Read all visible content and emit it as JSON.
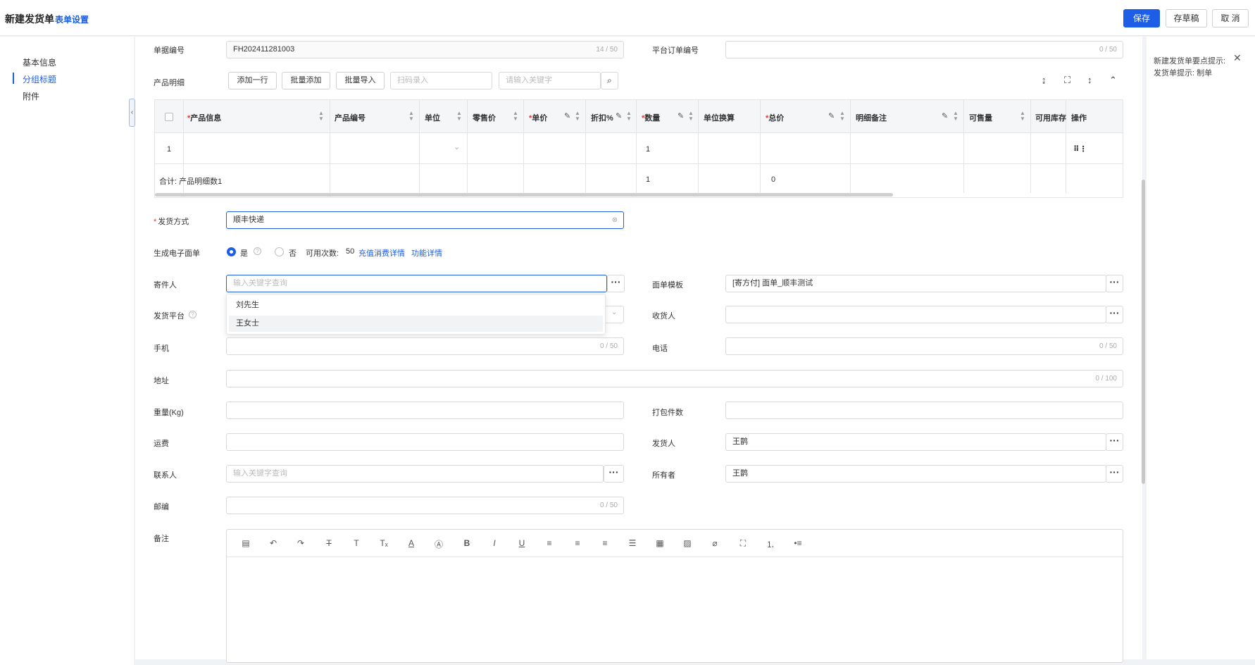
{
  "header": {
    "title": "新建发货单",
    "form_settings": "表单设置",
    "save": "保存",
    "draft": "存草稿",
    "cancel": "取 消"
  },
  "nav": {
    "items": [
      "基本信息",
      "分组标题",
      "附件"
    ],
    "active_index": 1
  },
  "tips": {
    "title": "新建发货单要点提示:",
    "body": "发货单提示: 制单"
  },
  "form": {
    "order_no": {
      "label": "单据编号",
      "value": "FH202411281003",
      "count": "14 / 50"
    },
    "platform_order": {
      "label": "平台订单编号",
      "count": "0 / 50"
    },
    "product_detail": {
      "label": "产品明细",
      "add_row": "添加一行",
      "batch_add": "批量添加",
      "batch_import": "批量导入",
      "scan_placeholder": "扫码录入",
      "search_placeholder": "请输入关键字"
    },
    "shipping_method": {
      "label": "发货方式",
      "value": "顺丰快递"
    },
    "e_waybill": {
      "label": "生成电子面单",
      "yes": "是",
      "no": "否",
      "available_label": "可用次数:",
      "available_count": "50",
      "recharge_link": "充值消费详情",
      "feature_link": "功能详情"
    },
    "sender": {
      "label": "寄件人",
      "placeholder": "输入关键字查询"
    },
    "sender_options": [
      "刘先生",
      "王女士"
    ],
    "waybill_template": {
      "label": "面单模板",
      "value": "[寄方付] 面单_顺丰测试"
    },
    "ship_platform": {
      "label": "发货平台"
    },
    "receiver": {
      "label": "收货人"
    },
    "mobile": {
      "label": "手机",
      "count": "0 / 50"
    },
    "phone": {
      "label": "电话",
      "count": "0 / 50"
    },
    "address": {
      "label": "地址",
      "count": "0 / 100"
    },
    "weight": {
      "label": "重量(Kg)"
    },
    "packages": {
      "label": "打包件数"
    },
    "freight": {
      "label": "运费"
    },
    "shipper": {
      "label": "发货人",
      "value": "王鹊"
    },
    "contact": {
      "label": "联系人",
      "placeholder": "输入关键字查询"
    },
    "owner": {
      "label": "所有者",
      "value": "王鹊"
    },
    "postcode": {
      "label": "邮编",
      "count": "0 / 50"
    },
    "remark": {
      "label": "备注"
    }
  },
  "grid": {
    "headers": [
      {
        "text": "产品信息",
        "required": true
      },
      {
        "text": "产品编号",
        "required": false
      },
      {
        "text": "单位",
        "required": false
      },
      {
        "text": "零售价",
        "required": false
      },
      {
        "text": "单价",
        "required": true
      },
      {
        "text": "折扣%",
        "required": false
      },
      {
        "text": "数量",
        "required": true
      },
      {
        "text": "单位换算",
        "required": false
      },
      {
        "text": "总价",
        "required": true
      },
      {
        "text": "明细备注",
        "required": false
      },
      {
        "text": "可售量",
        "required": false
      },
      {
        "text": "可用库存",
        "required": false
      },
      {
        "text": "操作",
        "required": false
      }
    ],
    "row": {
      "index": "1",
      "quantity": "1"
    },
    "total": {
      "label": "合计: 产品明细数1",
      "quantity": "1",
      "total_price": "0"
    }
  }
}
